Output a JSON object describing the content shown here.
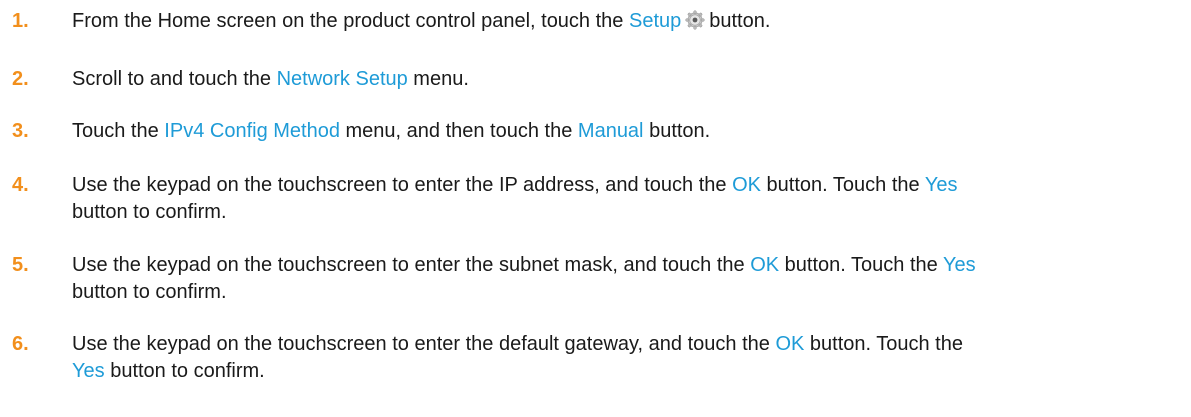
{
  "steps": [
    {
      "number": "1.",
      "parts": [
        "From the Home screen on the product control panel, touch the ",
        "Setup",
        "button."
      ]
    },
    {
      "number": "2.",
      "parts": [
        "Scroll to and touch the ",
        "Network Setup",
        " menu."
      ]
    },
    {
      "number": "3.",
      "parts": [
        "Touch the ",
        "IPv4 Config Method",
        " menu, and then touch the ",
        "Manual",
        " button."
      ]
    },
    {
      "number": "4.",
      "parts": [
        "Use the keypad on the touchscreen to enter the IP address, and touch the ",
        "OK",
        " button. Touch the ",
        "Yes",
        "button to confirm."
      ]
    },
    {
      "number": "5.",
      "parts": [
        "Use the keypad on the touchscreen to enter the subnet mask, and touch the ",
        "OK",
        " button. Touch the ",
        "Yes",
        "button to confirm."
      ]
    },
    {
      "number": "6.",
      "parts": [
        "Use the keypad on the touchscreen to enter the default gateway, and touch the ",
        "OK",
        " button. Touch the",
        "Yes",
        " button to confirm."
      ]
    }
  ],
  "icons": {
    "setup": "gear-icon"
  },
  "colors": {
    "step_number": "#f28f1c",
    "link": "#1e9bd7",
    "text": "#1a1a1a"
  }
}
